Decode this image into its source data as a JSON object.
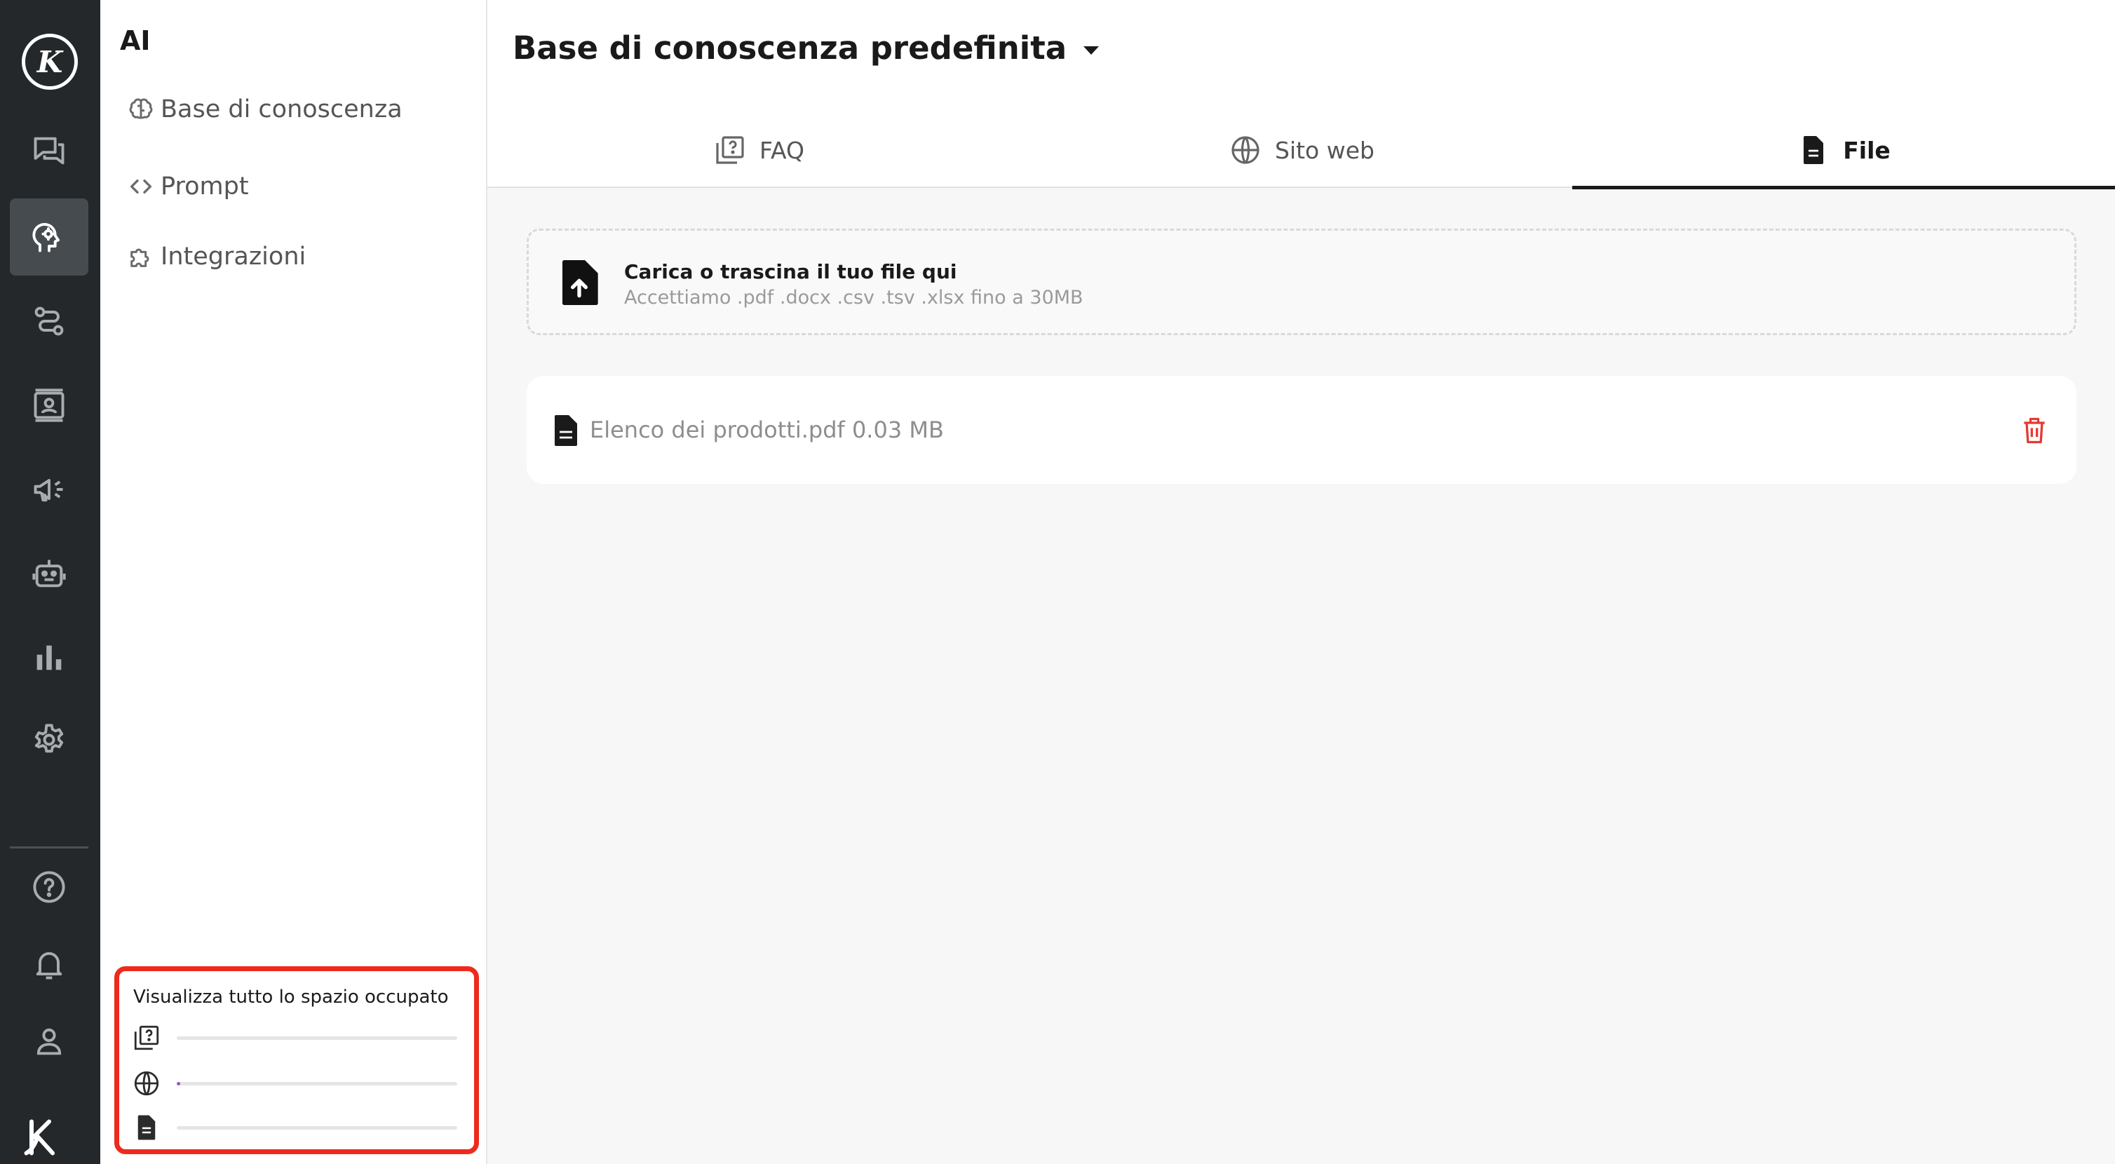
{
  "rail": {
    "items": [
      {
        "name": "conversations",
        "icon": "chat-bubbles-icon",
        "active": false
      },
      {
        "name": "ai",
        "icon": "ai-brain-head-icon",
        "active": true
      },
      {
        "name": "flows",
        "icon": "route-icon",
        "active": false
      },
      {
        "name": "contacts",
        "icon": "contact-card-icon",
        "active": false
      },
      {
        "name": "campaigns",
        "icon": "megaphone-icon",
        "active": false
      },
      {
        "name": "bots",
        "icon": "robot-icon",
        "active": false
      },
      {
        "name": "analytics",
        "icon": "bar-chart-icon",
        "active": false
      },
      {
        "name": "settings",
        "icon": "gear-icon",
        "active": false
      },
      {
        "name": "help",
        "icon": "help-circle-icon",
        "active": false
      },
      {
        "name": "notifications",
        "icon": "bell-icon",
        "active": false
      },
      {
        "name": "profile",
        "icon": "user-icon",
        "active": false
      }
    ]
  },
  "sidebar": {
    "title": "AI",
    "items": [
      {
        "label": "Base di conoscenza",
        "icon": "brain-icon"
      },
      {
        "label": "Prompt",
        "icon": "code-icon"
      },
      {
        "label": "Integrazioni",
        "icon": "puzzle-icon"
      }
    ],
    "usage": {
      "title": "Visualizza tutto lo spazio occupato",
      "rows": [
        {
          "icon": "faq-icon",
          "fraction": 0.0
        },
        {
          "icon": "globe-icon",
          "fraction": 0.012
        },
        {
          "icon": "file-icon",
          "fraction": 0.0
        }
      ]
    }
  },
  "main": {
    "kb_title": "Base di conoscenza predefinita",
    "tabs": [
      {
        "label": "FAQ",
        "icon": "faq-icon",
        "active": false
      },
      {
        "label": "Sito web",
        "icon": "globe-icon",
        "active": false
      },
      {
        "label": "File",
        "icon": "file-icon",
        "active": true
      }
    ],
    "dropzone": {
      "title": "Carica o trascina il tuo file qui",
      "subtitle": "Accettiamo .pdf .docx .csv .tsv .xlsx fino a 30MB"
    },
    "files": [
      {
        "name": "Elenco dei prodotti.pdf 0.03 MB"
      }
    ]
  },
  "colors": {
    "rail_bg": "#24282a",
    "rail_active": "#464b4f",
    "highlight_border": "#ee2a1d",
    "delete": "#e53935",
    "usage_fill": "#a14fc5"
  }
}
